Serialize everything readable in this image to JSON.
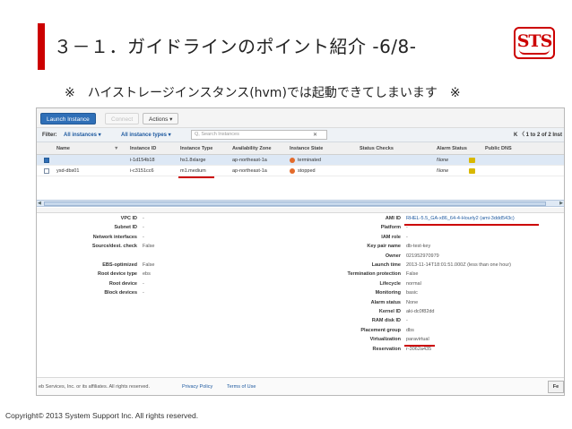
{
  "slide": {
    "title": "３－１．ガイドラインのポイント紹介 -6/8-",
    "subtitle": "※　ハイストレージインスタンス(hvm)では起動できてしまいます　※",
    "logo_text": "STS",
    "copyright": "Copyright© 2013  System Support Inc.  All rights reserved."
  },
  "toolbar": {
    "launch": "Launch Instance",
    "connect": "Connect",
    "actions": "Actions ▾"
  },
  "filter": {
    "label": "Filter:",
    "instances": "All instances ▾",
    "types": "All instance types ▾",
    "search_placeholder": "Q, Search Instances",
    "clear": "✕",
    "pager": "K  〈  1 to 2 of 2 Inst"
  },
  "grid": {
    "headers": [
      "Name",
      "Instance ID",
      "Instance Type",
      "Availability Zone",
      "Instance State",
      "Status Checks",
      "Alarm Status",
      "Public DNS"
    ],
    "rows": [
      {
        "name": "",
        "id": "i-1d154b18",
        "type": "hs1.8xlarge",
        "az": "ap-northeast-1a",
        "state": "terminated",
        "status": "",
        "alarm": "None"
      },
      {
        "name": "ysd-dbs01",
        "id": "i-c3151cc6",
        "type": "m1.medium",
        "az": "ap-northeast-1a",
        "state": "stopped",
        "status": "",
        "alarm": "None"
      }
    ]
  },
  "detail_left": [
    {
      "k": "VPC ID",
      "v": "-"
    },
    {
      "k": "Subnet ID",
      "v": "-"
    },
    {
      "k": "Network interfaces",
      "v": "-"
    },
    {
      "k": "Source/dest. check",
      "v": "False"
    },
    {
      "k": "",
      "v": ""
    },
    {
      "k": "EBS-optimized",
      "v": "False"
    },
    {
      "k": "Root device type",
      "v": "ebs"
    },
    {
      "k": "Root device",
      "v": "-"
    },
    {
      "k": "Block devices",
      "v": "-"
    }
  ],
  "detail_right": [
    {
      "k": "AMI ID",
      "v": "RHEL-5.5_GA-x86_64-4-Hourly2 (ami-3ddd543c)"
    },
    {
      "k": "Platform",
      "v": "-"
    },
    {
      "k": "IAM role",
      "v": "-"
    },
    {
      "k": "Key pair name",
      "v": "db-test-key"
    },
    {
      "k": "Owner",
      "v": "021952970979"
    },
    {
      "k": "Launch time",
      "v": "2013-11-14T18:01:51.000Z (less than one hour)"
    },
    {
      "k": "Termination protection",
      "v": "False"
    },
    {
      "k": "Lifecycle",
      "v": "normal"
    },
    {
      "k": "Monitoring",
      "v": "basic"
    },
    {
      "k": "Alarm status",
      "v": "None"
    },
    {
      "k": "Kernel ID",
      "v": "aki-dc0f82dd"
    },
    {
      "k": "RAM disk ID",
      "v": "-"
    },
    {
      "k": "Placement group",
      "v": "dbs"
    },
    {
      "k": "Virtualization",
      "v": "paravirtual"
    },
    {
      "k": "Reservation",
      "v": "r-3062a435"
    }
  ],
  "footer": {
    "legal": "eb Services, Inc. or its affiliates. All rights reserved.",
    "privacy": "Privacy Policy",
    "terms": "Terms of Use",
    "btn": "Fe"
  },
  "colors": {
    "accent": "#cc0000",
    "primary_button": "#2f6fb7",
    "link": "#1f5aa0"
  }
}
